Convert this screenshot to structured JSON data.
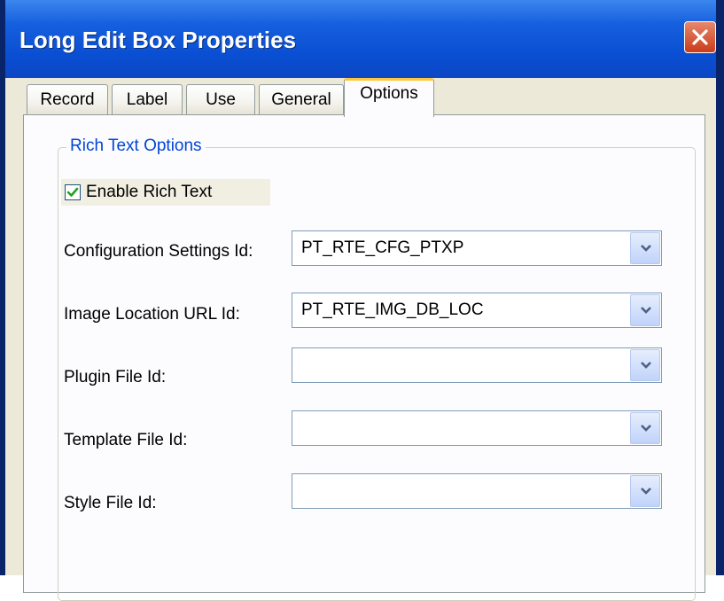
{
  "window": {
    "title": "Long Edit Box Properties",
    "close_icon": "close-icon"
  },
  "tabs": [
    {
      "label": "Record",
      "active": false
    },
    {
      "label": "Label",
      "active": false
    },
    {
      "label": "Use",
      "active": false
    },
    {
      "label": "General",
      "active": false
    },
    {
      "label": "Options",
      "active": true
    }
  ],
  "options": {
    "group_title": "Rich Text Options",
    "enable_rich_text": {
      "label": "Enable Rich Text",
      "checked": true
    },
    "fields": [
      {
        "label": "Configuration Settings Id:",
        "value": "PT_RTE_CFG_PTXP"
      },
      {
        "label": "Image Location URL Id:",
        "value": "PT_RTE_IMG_DB_LOC"
      },
      {
        "label": "Plugin File Id:",
        "value": ""
      },
      {
        "label": "Template File Id:",
        "value": ""
      },
      {
        "label": "Style File Id:",
        "value": ""
      }
    ]
  },
  "colors": {
    "titlebar": "#0a4fd3",
    "dialog_bg": "#ece9d8",
    "active_tab_accent": "#ffc83c",
    "group_title": "#0046d5",
    "close_button": "#c93c1b"
  }
}
